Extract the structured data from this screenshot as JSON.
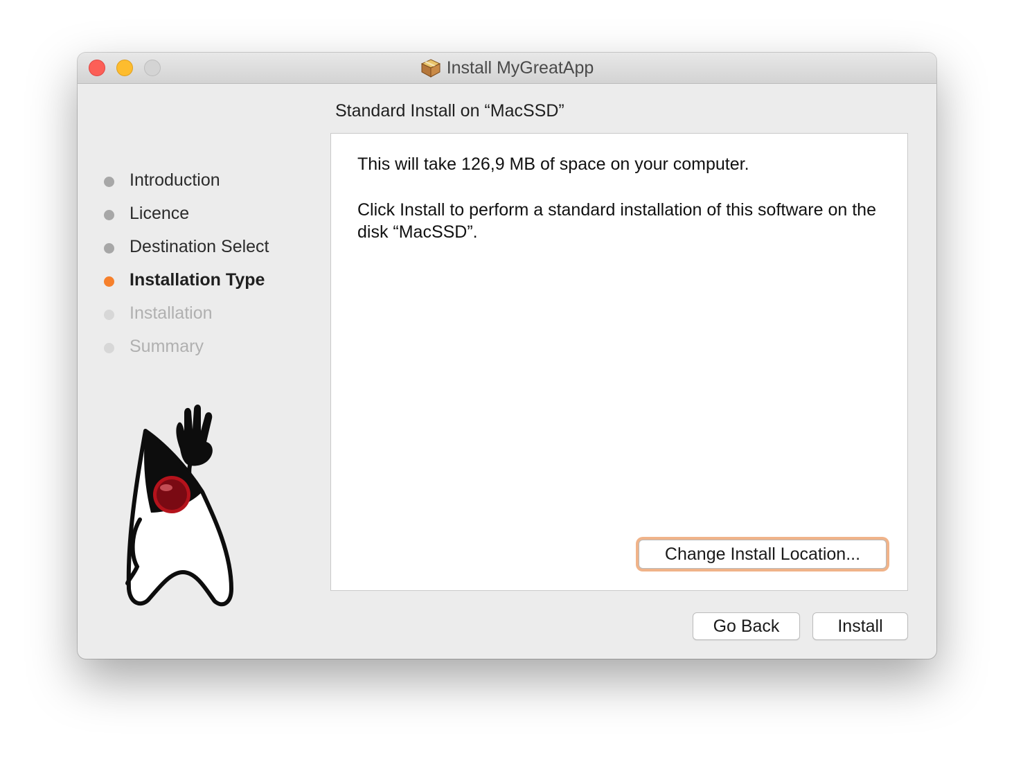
{
  "window": {
    "title": "Install MyGreatApp",
    "icon": "package-icon"
  },
  "sidebar": {
    "steps": [
      {
        "label": "Introduction",
        "state": "done"
      },
      {
        "label": "Licence",
        "state": "done"
      },
      {
        "label": "Destination Select",
        "state": "done"
      },
      {
        "label": "Installation Type",
        "state": "active"
      },
      {
        "label": "Installation",
        "state": "pending"
      },
      {
        "label": "Summary",
        "state": "pending"
      }
    ],
    "mascot": "java-duke-mascot"
  },
  "content": {
    "header": "Standard Install on “MacSSD”",
    "space_text": "This will take 126,9 MB of space on your computer.",
    "instruction_text": "Click Install to perform a standard installation of this software on the disk “MacSSD”.",
    "change_location_label": "Change Install Location..."
  },
  "footer": {
    "back_label": "Go Back",
    "install_label": "Install"
  },
  "colors": {
    "active_step": "#f6802c",
    "focus_ring": "#f0b389",
    "close": "#fc5f57",
    "minimize": "#fdbc2e"
  }
}
